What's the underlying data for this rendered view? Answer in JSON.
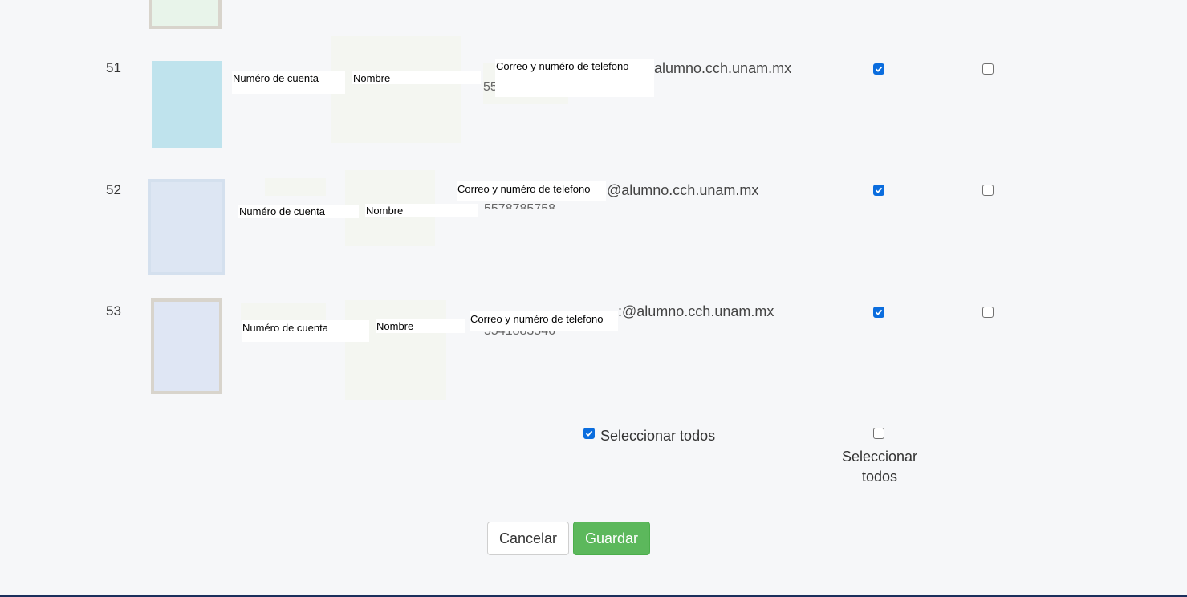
{
  "rows": [
    {
      "number": "51",
      "account_label": "Numéro de cuenta",
      "name_label": "Nombre",
      "contact_label": "Correo y numéro de telefono",
      "email_suffix": "alumno.cch.unam.mx",
      "phone_fragment": "55",
      "checked_col1": true,
      "checked_col2": false
    },
    {
      "number": "52",
      "account_label": "Numéro de cuenta",
      "name_label": "Nombre",
      "contact_label": "Correo y numéro de telefono",
      "email_suffix": "@alumno.cch.unam.mx",
      "phone_fragment": "5578785758",
      "checked_col1": true,
      "checked_col2": false
    },
    {
      "number": "53",
      "account_label": "Numéro de cuenta",
      "name_label": "Nombre",
      "contact_label": "Correo y numéro de telefono",
      "email_suffix": ":@alumno.cch.unam.mx",
      "phone_fragment": "5541883546",
      "checked_col1": true,
      "checked_col2": false
    }
  ],
  "select_all": {
    "col1_label": "Seleccionar todos",
    "col1_checked": true,
    "col2_label_line1": "Seleccionar",
    "col2_label_line2": "todos",
    "col2_checked": false
  },
  "buttons": {
    "cancel": "Cancelar",
    "save": "Guardar"
  },
  "colors": {
    "checkbox_on": "#0b6dde",
    "save_button": "#5cb85c",
    "footer_bar": "#1b2f5c"
  }
}
